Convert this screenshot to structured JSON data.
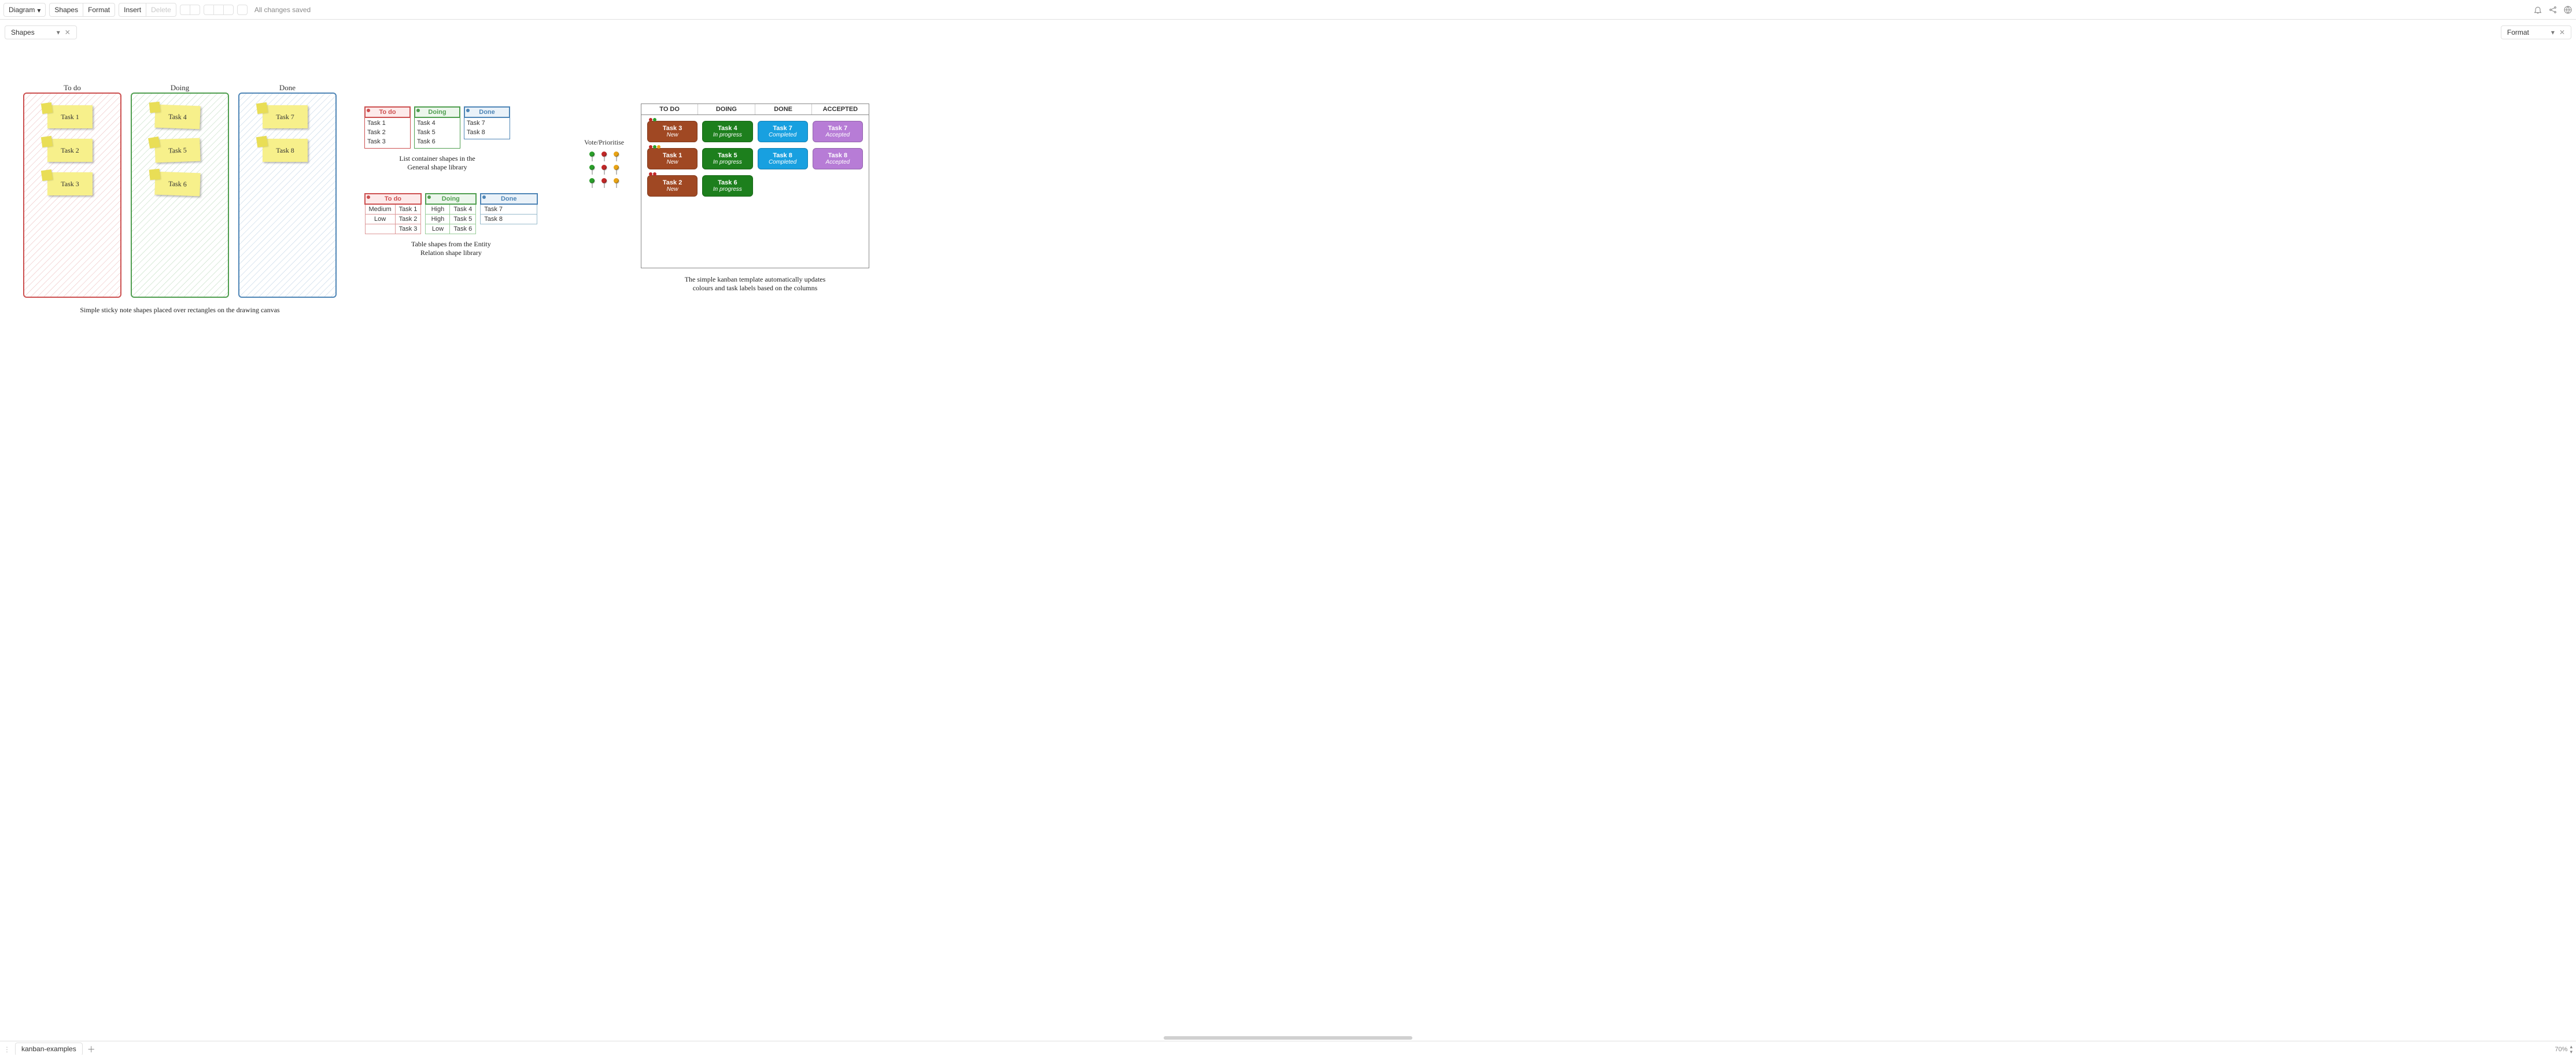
{
  "toolbar": {
    "diagram": "Diagram",
    "shapes": "Shapes",
    "format": "Format",
    "insert": "Insert",
    "delete": "Delete",
    "save_status": "All changes saved"
  },
  "panels": {
    "left": "Shapes",
    "right": "Format"
  },
  "sketch": {
    "columns": [
      {
        "title": "To do",
        "color": "#cc4f4f",
        "notes": [
          "Task 1",
          "Task 2",
          "Task 3"
        ]
      },
      {
        "title": "Doing",
        "color": "#4f9e4f",
        "notes": [
          "Task 4",
          "Task 5",
          "Task 6"
        ]
      },
      {
        "title": "Done",
        "color": "#4e85b6",
        "notes": [
          "Task 7",
          "Task 8"
        ]
      }
    ],
    "caption": "Simple sticky note shapes placed over rectangles on the drawing canvas"
  },
  "lists": {
    "columns": [
      {
        "title": "To do",
        "class": "red",
        "items": [
          "Task 1",
          "Task 2",
          "Task 3"
        ]
      },
      {
        "title": "Doing",
        "class": "green",
        "items": [
          "Task 4",
          "Task 5",
          "Task 6"
        ]
      },
      {
        "title": "Done",
        "class": "blue",
        "items": [
          "Task 7",
          "Task 8"
        ]
      }
    ],
    "caption_line1": "List container shapes in the",
    "caption_line2": "General shape library"
  },
  "tables": {
    "columns": [
      {
        "title": "To do",
        "class": "red",
        "rows": [
          [
            "Medium",
            "Task 1"
          ],
          [
            "Low",
            "Task 2"
          ],
          [
            "",
            "Task 3"
          ]
        ]
      },
      {
        "title": "Doing",
        "class": "green",
        "rows": [
          [
            "High",
            "Task 4"
          ],
          [
            "High",
            "Task 5"
          ],
          [
            "Low",
            "Task 6"
          ]
        ]
      },
      {
        "title": "Done",
        "class": "blue",
        "rows": [
          [
            "",
            "Task 7"
          ],
          [
            "",
            "Task 8"
          ]
        ]
      }
    ],
    "caption_line1": "Table shapes from the Entity",
    "caption_line2": "Relation shape library"
  },
  "vote": {
    "title": "Vote/Prioritise",
    "rows": [
      [
        "#2a9e2a",
        "#c02828",
        "#e8a315"
      ],
      [
        "#2a9e2a",
        "#c02828",
        "#e8a315"
      ],
      [
        "#2a9e2a",
        "#c02828",
        "#e8a315"
      ]
    ]
  },
  "kanban": {
    "headers": [
      "TO DO",
      "DOING",
      "DONE",
      "ACCEPTED"
    ],
    "cards": [
      [
        {
          "title": "Task 3",
          "status": "New",
          "class": "brown",
          "dots": [
            "#c02828",
            "#2a9e2a"
          ]
        },
        {
          "title": "Task 1",
          "status": "New",
          "class": "brown",
          "dots": [
            "#c02828",
            "#2a9e2a",
            "#e8a315"
          ]
        },
        {
          "title": "Task 2",
          "status": "New",
          "class": "brown",
          "dots": [
            "#c02828",
            "#c02828"
          ]
        }
      ],
      [
        {
          "title": "Task 4",
          "status": "In progress",
          "class": "green"
        },
        {
          "title": "Task 5",
          "status": "In progress",
          "class": "green"
        },
        {
          "title": "Task 6",
          "status": "In progress",
          "class": "green"
        }
      ],
      [
        {
          "title": "Task 7",
          "status": "Completed",
          "class": "cyan"
        },
        {
          "title": "Task 8",
          "status": "Completed",
          "class": "cyan"
        }
      ],
      [
        {
          "title": "Task 7",
          "status": "Accepted",
          "class": "purple"
        },
        {
          "title": "Task 8",
          "status": "Accepted",
          "class": "purple"
        }
      ]
    ],
    "caption_line1": "The simple kanban template automatically updates",
    "caption_line2": "colours and task labels based on the columns"
  },
  "footer": {
    "tab": "kanban-examples",
    "zoom": "70%"
  }
}
